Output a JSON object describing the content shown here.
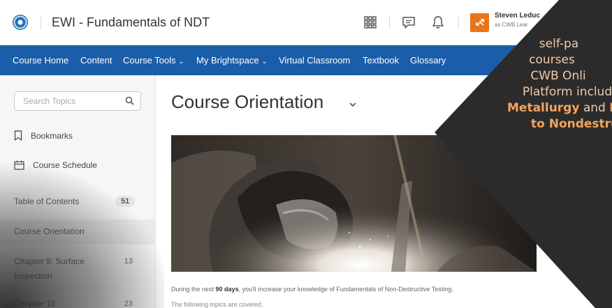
{
  "header": {
    "logo_icon": "globe-logo-icon",
    "app_title": "EWI - Fundamentals of NDT",
    "icons": [
      "app-launcher-grid-icon",
      "message-bubble-icon",
      "notification-bell-icon"
    ],
    "user": {
      "name": "Steven Leduc",
      "role": "as CWB Lear",
      "avatar_icon": "swap-arrows-icon",
      "avatar_color": "#e8751a"
    }
  },
  "nav": {
    "color": "#1a5da8",
    "items": [
      "Course Home",
      "Content",
      "Course Tools",
      "My Brightspace",
      "Virtual Classroom",
      "Textbook",
      "Glossary"
    ]
  },
  "sidebar": {
    "search_placeholder": "Search Topics",
    "bookmarks": "Bookmarks",
    "schedule": "Course Schedule",
    "toc_label": "Table of Contents",
    "toc_count": "51",
    "items": [
      {
        "label": "Course Orientation",
        "count": ""
      },
      {
        "label": "Chapter 9: Surface Inspection",
        "count": "13"
      },
      {
        "label": "Chapter 10",
        "count": "23"
      }
    ]
  },
  "main": {
    "title": "Course Orientation",
    "hero_alt_icon": "welder-image",
    "intro_prefix": "During the next ",
    "intro_bold": "90 days",
    "intro_suffix": ", you'll increase your knowledge of Fundamentals of Non-Destructive Testing.",
    "intro_line2": "The following topics are covered."
  },
  "overlay": {
    "line1": "self-pa",
    "line2": "courses",
    "line3": "CWB Onli",
    "line4": "Platform includ",
    "bold1": "Metallurgy",
    "and": " and ",
    "bold2": "In",
    "line6": "to Nondestruct",
    "bg": "#2b2b2b",
    "text_color": "#f2c9a8",
    "accent": "#f3a45f"
  }
}
